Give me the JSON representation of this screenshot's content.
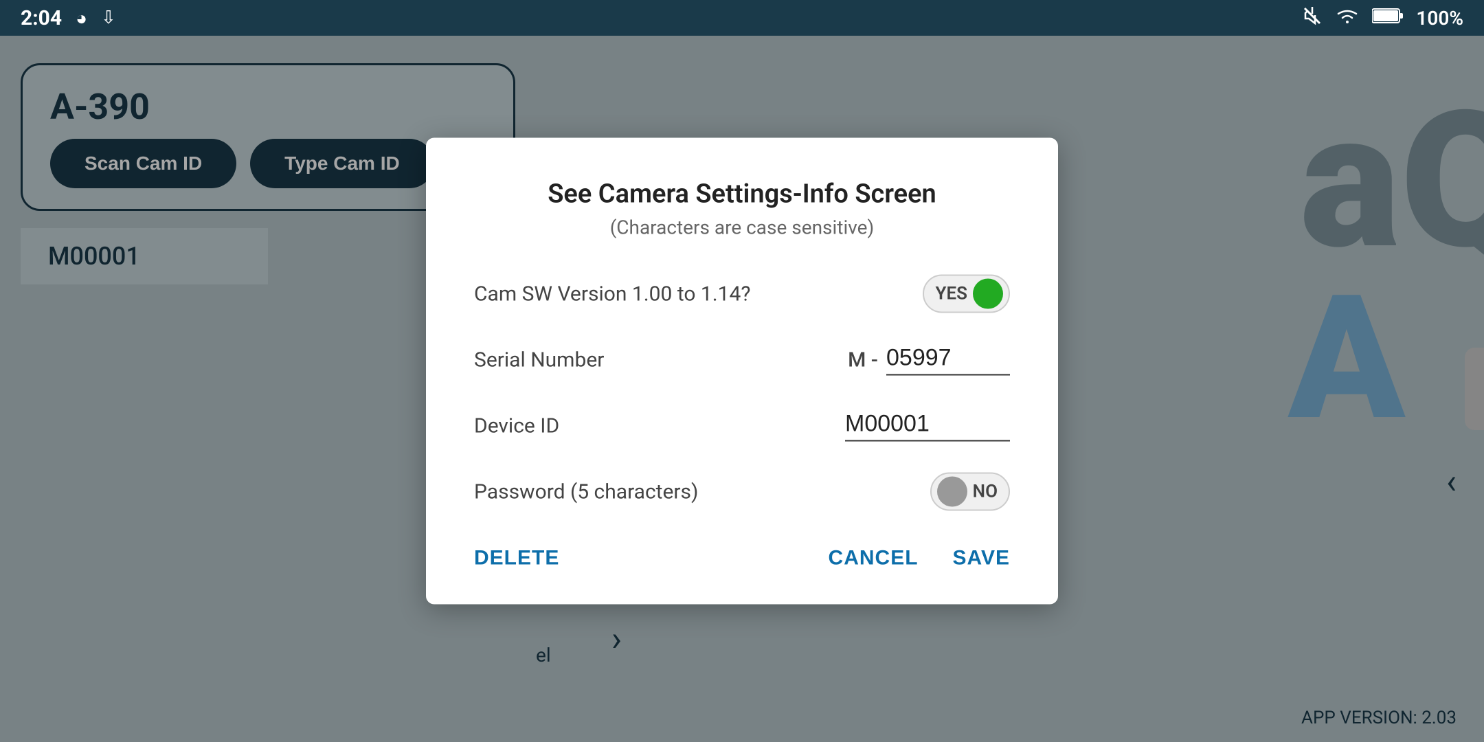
{
  "statusBar": {
    "time": "2:04",
    "batteryLevel": "100%"
  },
  "background": {
    "cardTitle": "A-390",
    "scanButton": "Scan\nCam ID",
    "typeButton": "Type\nCam ID",
    "rowLabel": "M00001",
    "versionLabel": "APP VERSION: 2.03",
    "navLabel": "el"
  },
  "dialog": {
    "title": "See Camera Settings-Info Screen",
    "subtitle": "(Characters are case sensitive)",
    "fields": {
      "camSwLabel": "Cam SW Version 1.00 to 1.14?",
      "camSwToggle": "YES",
      "camSwToggleState": true,
      "serialLabel": "Serial Number",
      "serialPrefix": "M -",
      "serialValue": "05997",
      "deviceIdLabel": "Device ID",
      "deviceIdValue": "M00001",
      "passwordLabel": "Password (5 characters)",
      "passwordToggle": "NO",
      "passwordToggleState": false
    },
    "actions": {
      "deleteLabel": "DELETE",
      "cancelLabel": "CANCEL",
      "saveLabel": "SAVE"
    }
  }
}
